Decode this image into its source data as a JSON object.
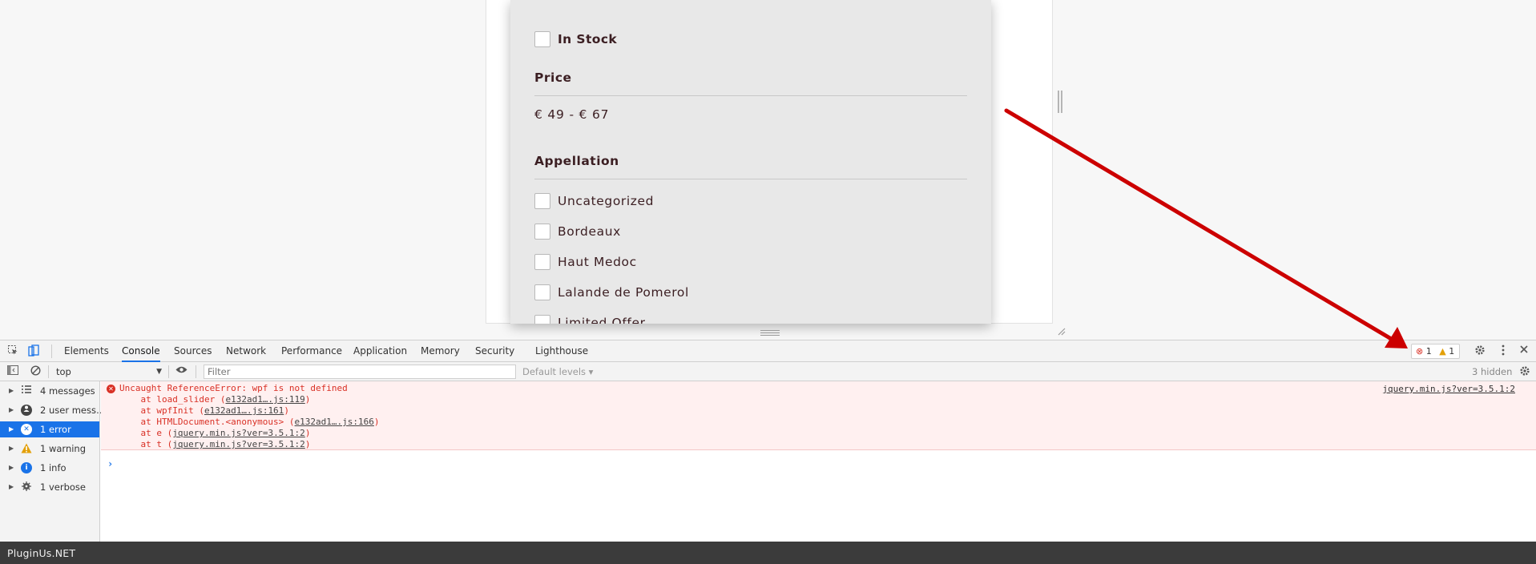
{
  "filters": {
    "in_stock_label": "In Stock",
    "price": {
      "title": "Price",
      "range": "€ 49 - € 67"
    },
    "appellation": {
      "title": "Appellation",
      "items": [
        "Uncategorized",
        "Bordeaux",
        "Haut Medoc",
        "Lalande de Pomerol",
        "Limited Offer"
      ]
    }
  },
  "devtools": {
    "tabs": [
      "Elements",
      "Console",
      "Sources",
      "Network",
      "Performance",
      "Application",
      "Memory",
      "Security",
      "Lighthouse"
    ],
    "active_tab": "Console",
    "issues": {
      "errors": "1",
      "warnings": "1"
    },
    "toolbar": {
      "context": "top",
      "filter_placeholder": "Filter",
      "levels": "Default levels ▾",
      "hidden": "3 hidden"
    },
    "sidebar": [
      {
        "label": "4 messages",
        "icon": "list-icon"
      },
      {
        "label": "2 user mess…",
        "icon": "user-icon"
      },
      {
        "label": "1 error",
        "icon": "error-icon"
      },
      {
        "label": "1 warning",
        "icon": "warning-icon"
      },
      {
        "label": "1 info",
        "icon": "info-icon"
      },
      {
        "label": "1 verbose",
        "icon": "verbose-icon"
      }
    ],
    "error": {
      "message": "Uncaught ReferenceError: wpf is not defined",
      "source": "jquery.min.js?ver=3.5.1:2",
      "stack": [
        {
          "prefix": "    at load_slider (",
          "link": "e132ad1….js:119",
          "suffix": ")"
        },
        {
          "prefix": "    at wpfInit (",
          "link": "e132ad1….js:161",
          "suffix": ")"
        },
        {
          "prefix": "    at HTMLDocument.<anonymous> (",
          "link": "e132ad1….js:166",
          "suffix": ")"
        },
        {
          "prefix": "    at e (",
          "link": "jquery.min.js?ver=3.5.1:2",
          "suffix": ")"
        },
        {
          "prefix": "    at t (",
          "link": "jquery.min.js?ver=3.5.1:2",
          "suffix": ")"
        }
      ]
    },
    "prompt": "›"
  },
  "brand": {
    "text": "PluginUs.NET"
  },
  "colors": {
    "accent": "#1a73e8",
    "error": "#d93025",
    "warning": "#e3a008",
    "info": "#1a73e8",
    "arrow": "#cc0000",
    "label_text": "#3b1e22"
  }
}
